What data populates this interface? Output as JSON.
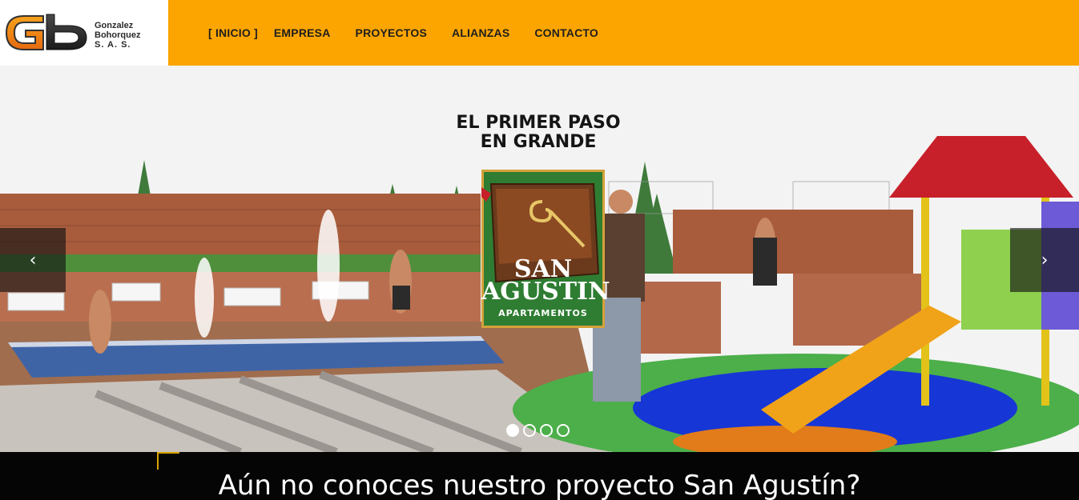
{
  "header": {
    "logo": {
      "mark_letters": "Gb",
      "line1": "Gonzalez",
      "line2": "Bohorquez",
      "line3": "S. A. S."
    },
    "nav": [
      {
        "label": "[ INICIO ]"
      },
      {
        "label": "EMPRESA"
      },
      {
        "label": "PROYECTOS"
      },
      {
        "label": "ALIANZAS"
      },
      {
        "label": "CONTACTO"
      }
    ],
    "background_color": "#fca500"
  },
  "slider": {
    "tagline_line1": "EL PRIMER PASO",
    "tagline_line2": "EN GRANDE",
    "brand": {
      "name_line1": "SAN",
      "name_line2": "AGUSTIN",
      "subtitle": "APARTAMENTOS",
      "background_color": "#2e7d32"
    },
    "prev_icon": "chevron-left-icon",
    "next_icon": "chevron-right-icon",
    "prev_glyph": "‹",
    "next_glyph": "›",
    "slide_count": 4,
    "active_slide": 1
  },
  "banner": {
    "text": "Aún no conoces nuestro proyecto San Agustín?"
  }
}
